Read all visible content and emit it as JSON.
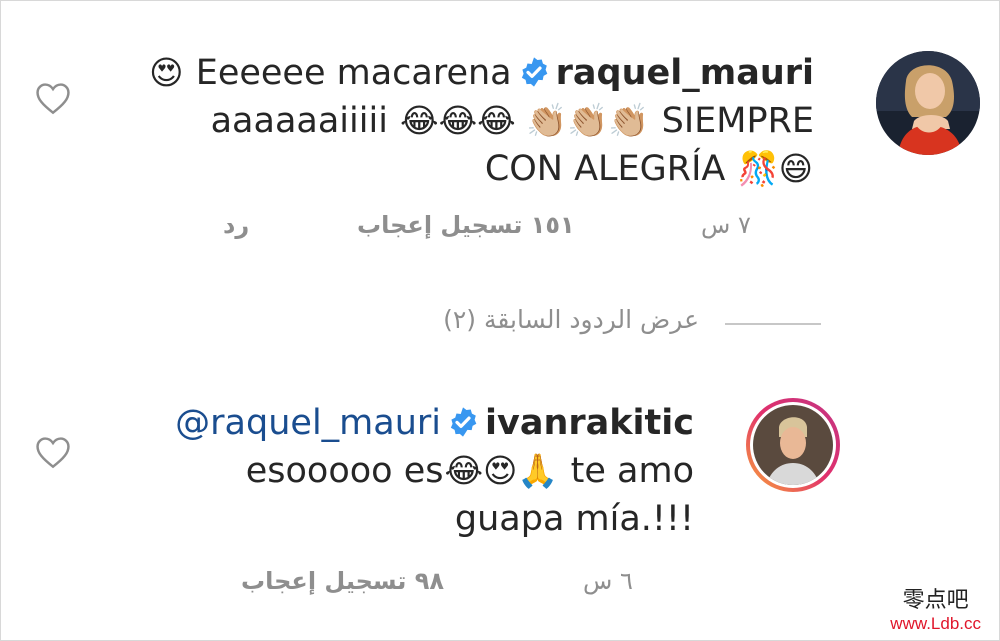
{
  "comments": [
    {
      "username": "raquel_mauri",
      "lines": [
        {
          "lead_emoji": "😍",
          "text": " Eeeeee macarena"
        },
        {
          "text": "aaaaaaiiiii ",
          "emoji": "😂😂😂 👏🏼👏🏼👏🏼",
          "tail": " SIEMPRE"
        },
        {
          "text": "CON ALEGRÍA ",
          "emoji": "🎊😄"
        }
      ],
      "time": "٧ س",
      "likes": "١٥١ تسجيل إعجاب",
      "reply": "رد"
    },
    {
      "username": "ivanrakitic",
      "mention": "@raquel_mauri",
      "lines": [
        {
          "text": "esooooo es",
          "emoji": "😂😍🙏",
          "tail": " te amo"
        },
        {
          "text": "guapa mía.!!!"
        }
      ],
      "time": "٦ س",
      "likes": "٩٨ تسجيل إعجاب"
    }
  ],
  "view_previous_replies": "عرض الردود السابقة (٢)",
  "watermark": {
    "cn": "零点吧",
    "url": "www.Ldb.cc"
  },
  "colors": {
    "verified": "#3897f0",
    "mention": "#1a4d8f",
    "meta": "#8e8e8e",
    "story_ring": "#d6249f"
  },
  "icons": [
    "heart-outline-icon",
    "verified-badge-icon"
  ]
}
